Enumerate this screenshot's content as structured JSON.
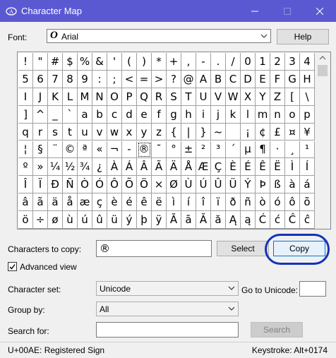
{
  "window": {
    "title": "Character Map",
    "app_icon": "character-map-icon"
  },
  "font": {
    "label": "Font:",
    "value": "Arial",
    "icon": "opentype-icon"
  },
  "help_label": "Help",
  "grid": {
    "rows": [
      [
        "!",
        "\"",
        "#",
        "$",
        "%",
        "&",
        "'",
        "(",
        ")",
        "*",
        "+",
        ",",
        "-",
        ".",
        "/",
        "0",
        "1",
        "2",
        "3",
        "4"
      ],
      [
        "5",
        "6",
        "7",
        "8",
        "9",
        ":",
        ";",
        "<",
        "=",
        ">",
        "?",
        "@",
        "A",
        "B",
        "C",
        "D",
        "E",
        "F",
        "G",
        "H"
      ],
      [
        "I",
        "J",
        "K",
        "L",
        "M",
        "N",
        "O",
        "P",
        "Q",
        "R",
        "S",
        "T",
        "U",
        "V",
        "W",
        "X",
        "Y",
        "Z",
        "[",
        "\\"
      ],
      [
        "]",
        "^",
        "_",
        "`",
        "a",
        "b",
        "c",
        "d",
        "e",
        "f",
        "g",
        "h",
        "i",
        "j",
        "k",
        "l",
        "m",
        "n",
        "o",
        "p"
      ],
      [
        "q",
        "r",
        "s",
        "t",
        "u",
        "v",
        "w",
        "x",
        "y",
        "z",
        "{",
        "|",
        "}",
        "~",
        " ",
        "¡",
        "¢",
        "£",
        "¤",
        "¥"
      ],
      [
        "¦",
        "§",
        "¨",
        "©",
        "ª",
        "«",
        "¬",
        "-",
        "®",
        "¯",
        "°",
        "±",
        "²",
        "³",
        "´",
        "µ",
        "¶",
        "·",
        "¸",
        "¹"
      ],
      [
        "º",
        "»",
        "¼",
        "½",
        "¾",
        "¿",
        "À",
        "Á",
        "Â",
        "Ã",
        "Ä",
        "Å",
        "Æ",
        "Ç",
        "È",
        "É",
        "Ê",
        "Ë",
        "Ì",
        "Í"
      ],
      [
        "Î",
        "Ï",
        "Ð",
        "Ñ",
        "Ò",
        "Ó",
        "Ô",
        "Õ",
        "Ö",
        "×",
        "Ø",
        "Ù",
        "Ú",
        "Û",
        "Ü",
        "Ý",
        "Þ",
        "ß",
        "à",
        "á"
      ],
      [
        "â",
        "ã",
        "ä",
        "å",
        "æ",
        "ç",
        "è",
        "é",
        "ê",
        "ë",
        "ì",
        "í",
        "î",
        "ï",
        "ð",
        "ñ",
        "ò",
        "ó",
        "ô",
        "õ"
      ],
      [
        "ö",
        "÷",
        "ø",
        "ù",
        "ú",
        "û",
        "ü",
        "ý",
        "þ",
        "ÿ",
        "Ā",
        "ā",
        "Ă",
        "ă",
        "Ą",
        "ą",
        "Ć",
        "ć",
        "Ĉ",
        "ĉ"
      ]
    ],
    "selected": [
      5,
      8
    ]
  },
  "copy_section": {
    "label": "Characters to copy:",
    "value": "®",
    "select_label": "Select",
    "copy_label": "Copy"
  },
  "advanced_view": {
    "label": "Advanced view",
    "checked": true
  },
  "character_set": {
    "label": "Character set:",
    "value": "Unicode"
  },
  "goto_unicode": {
    "label": "Go to Unicode:",
    "value": ""
  },
  "group_by": {
    "label": "Group by:",
    "value": "All"
  },
  "search": {
    "label": "Search for:",
    "value": "",
    "button_label": "Search"
  },
  "status": {
    "left": "U+00AE: Registered Sign",
    "right": "Keystroke: Alt+0174"
  },
  "colors": {
    "titlebar": "#5b59d2",
    "annotation": "#1532b8",
    "window_bg": "#f0f0f0"
  }
}
